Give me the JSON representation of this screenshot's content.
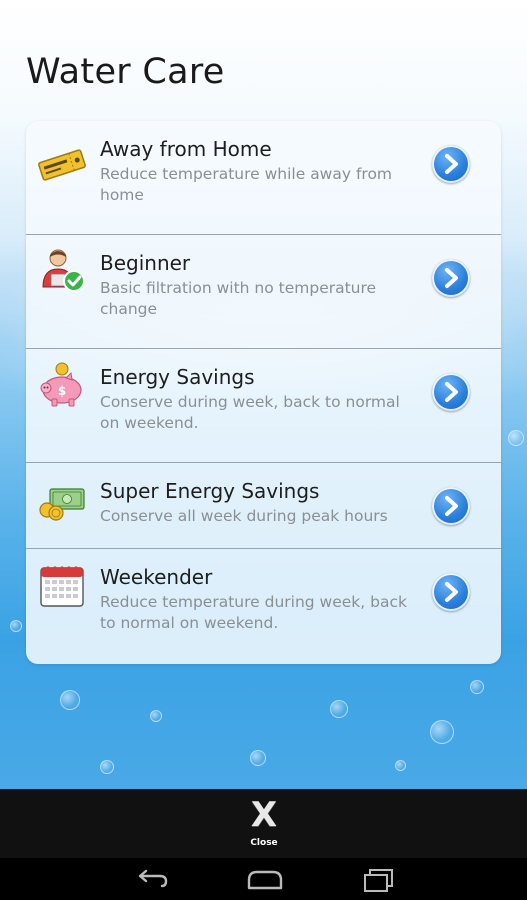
{
  "header": {
    "title": "Water Care"
  },
  "modes": [
    {
      "title": "Away from Home",
      "description": "Reduce temperature while away from home",
      "icon": "ticket-icon"
    },
    {
      "title": "Beginner",
      "description": "Basic filtration with no temperature change",
      "icon": "beginner-person-check-icon"
    },
    {
      "title": "Energy Savings",
      "description": "Conserve during week, back to normal on weekend.",
      "icon": "piggy-bank-icon"
    },
    {
      "title": "Super Energy Savings",
      "description": "Conserve all week during peak hours",
      "icon": "money-coins-icon"
    },
    {
      "title": "Weekender",
      "description": "Reduce temperature during week, back to normal on weekend.",
      "icon": "calendar-icon"
    }
  ],
  "bottom_bar": {
    "close_icon": "X",
    "close_label": "Close"
  },
  "nav": {
    "back": "back-icon",
    "home": "home-icon",
    "recents": "recents-icon"
  },
  "colors": {
    "chevron_blue": "#2a7fdc",
    "water_blue": "#3aa2e4",
    "bottom_bar": "#111111"
  }
}
